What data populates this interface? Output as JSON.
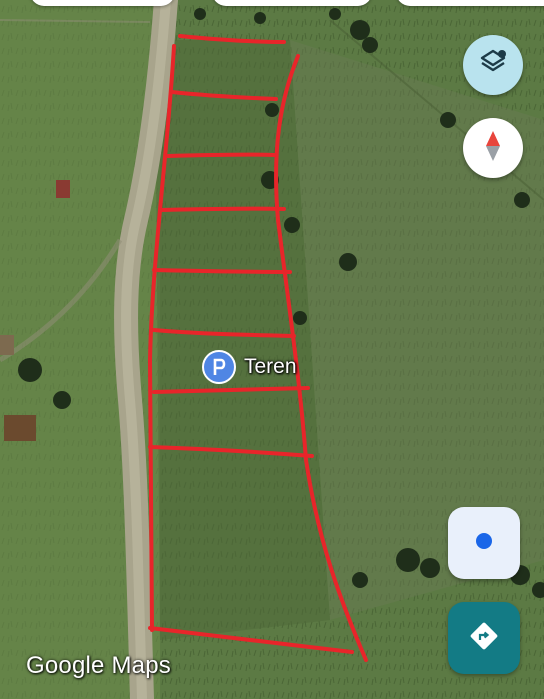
{
  "place": {
    "label": "Teren",
    "icon": "parking-pin-icon"
  },
  "attribution": {
    "logo_text": "Google Maps"
  },
  "controls": {
    "layers": {
      "icon": "layers-icon",
      "bg": "#b9e3ee"
    },
    "compass": {
      "icon": "compass-icon"
    },
    "my_location": {
      "icon": "my-location-icon",
      "bg": "#e9f0fb",
      "dot": "#1a66e8"
    },
    "directions": {
      "icon": "directions-icon",
      "bg": "#137b85"
    }
  },
  "colors": {
    "boundary_lines": "#e8252a",
    "pin": "#4f86e4"
  }
}
